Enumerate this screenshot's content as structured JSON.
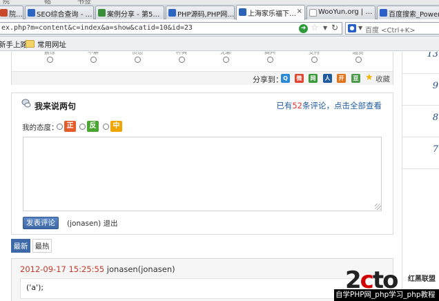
{
  "browser": {
    "menu_items": [
      "院",
      "帖",
      "书签"
    ],
    "tabs": [
      {
        "label": "院…",
        "active": false,
        "favicon_color": "#c94a2a"
      },
      {
        "label": "SEO综合查询 - …",
        "active": false,
        "favicon_color": "#2b66c2"
      },
      {
        "label": "案例分享 - 第5…",
        "active": false,
        "favicon_color": "#3a8f3a"
      },
      {
        "label": "PHP源码,PHP网…",
        "active": false,
        "favicon_color": "#2b66c2"
      },
      {
        "label": "上海家乐福下…",
        "active": true,
        "favicon_color": "#2a63b8"
      },
      {
        "label": "WooYun.org | …",
        "active": false,
        "favicon_color": "#666666"
      },
      {
        "label": "百度搜索_Power…",
        "active": false,
        "favicon_color": "#2a5ec8"
      }
    ],
    "tab_close": "×",
    "url": "ex.php?m=content&c=index&a=show&catid=10&id=23",
    "search_placeholder": "百度 <Ctrl+K>",
    "bookmarks": [
      "新手上路",
      "常用网址"
    ]
  },
  "vote": {
    "labels": [
      "震惊",
      "不解",
      "愤怒",
      "杯具",
      "无聊",
      "高兴",
      "支持",
      "超赞"
    ]
  },
  "share": {
    "label": "分享到：",
    "icons": [
      {
        "name": "qzone-icon",
        "glyph": "Q",
        "color": "#2a8ad8"
      },
      {
        "name": "weibo-icon",
        "glyph": "微",
        "color": "#e2432d"
      },
      {
        "name": "netease-icon",
        "glyph": "网",
        "color": "#3a9a3a"
      },
      {
        "name": "renren-icon",
        "glyph": "人",
        "color": "#1f5a9e"
      },
      {
        "name": "kaixin-icon",
        "glyph": "开",
        "color": "#e1731a"
      },
      {
        "name": "douban-icon",
        "glyph": "豆",
        "color": "#4c9a4c"
      }
    ],
    "favorite_label": "收藏"
  },
  "comment_form": {
    "title": "我来说两句",
    "count_prefix": "已有",
    "count": "52",
    "count_suffix": "条评论，点击全部查看",
    "attitude_label": "我的态度：",
    "attitudes": [
      {
        "label": "正",
        "color": "#e35d2a"
      },
      {
        "label": "反",
        "color": "#4aa531"
      },
      {
        "label": "中",
        "color": "#f0a400"
      }
    ],
    "textarea_value": "",
    "submit_label": "发表评论",
    "user": "(jonasen)",
    "logout_label": "退出"
  },
  "sort_tabs": [
    {
      "label": "最新",
      "active": true
    },
    {
      "label": "最热",
      "active": false
    }
  ],
  "comments": [
    {
      "time": "2012-09-17 15:25:55",
      "user": "jonasen(jonasen)",
      "body": "('a');"
    }
  ],
  "right_rail": [
    "13",
    "9",
    "8",
    "7"
  ],
  "watermark": {
    "logo_prefix": "2",
    "logo_mid": "c",
    "logo_suffix": "to",
    "tagline": "红黑联盟",
    "bar_text": "自学PHP网_php学习_php教程"
  }
}
